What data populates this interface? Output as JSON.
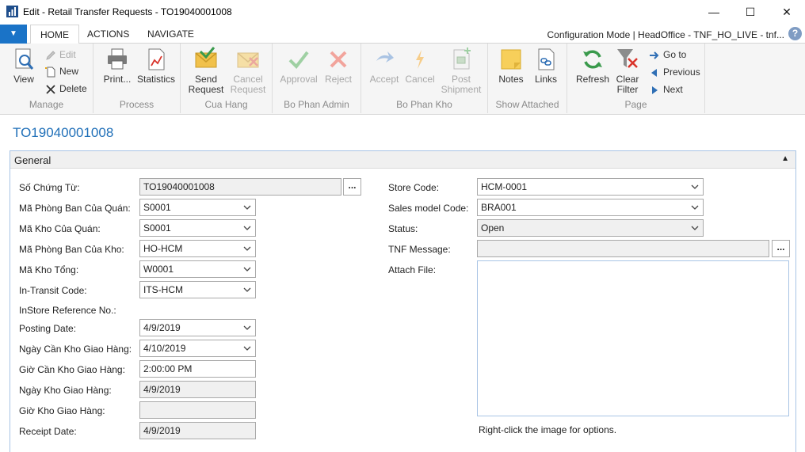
{
  "window": {
    "title": "Edit - Retail Transfer Requests - TO19040001008",
    "minimize": "—",
    "maximize": "☐",
    "close": "✕"
  },
  "tabs": {
    "file_menu": "▼",
    "home": "HOME",
    "actions": "ACTIONS",
    "navigate": "NAVIGATE",
    "config_status": "Configuration Mode | HeadOffice - TNF_HO_LIVE - tnf...",
    "help": "?"
  },
  "ribbon": {
    "manage": {
      "label": "Manage",
      "view": "View",
      "edit": "Edit",
      "new": "New",
      "delete": "Delete"
    },
    "process": {
      "label": "Process",
      "print": "Print...",
      "statistics": "Statistics"
    },
    "cua_hang": {
      "label": "Cua Hang",
      "send_l1": "Send",
      "send_l2": "Request",
      "cancel_l1": "Cancel",
      "cancel_l2": "Request"
    },
    "bo_phan_admin": {
      "label": "Bo Phan Admin",
      "approval": "Approval",
      "reject": "Reject"
    },
    "bo_phan_kho": {
      "label": "Bo Phan Kho",
      "accept": "Accept",
      "cancel": "Cancel",
      "post_l1": "Post",
      "post_l2": "Shipment"
    },
    "show_attached": {
      "label": "Show Attached",
      "notes": "Notes",
      "links": "Links"
    },
    "page": {
      "label": "Page",
      "refresh": "Refresh",
      "clear_l1": "Clear",
      "clear_l2": "Filter",
      "goto": "Go to",
      "previous": "Previous",
      "next": "Next"
    }
  },
  "page_title": "TO19040001008",
  "general": {
    "header": "General",
    "left": [
      {
        "label": "Số Chứng Từ:",
        "value": "TO19040001008"
      },
      {
        "label": "Mã Phòng Ban Của Quán:",
        "value": "S0001"
      },
      {
        "label": "Mã Kho Của Quán:",
        "value": "S0001"
      },
      {
        "label": "Mã Phòng Ban Của Kho:",
        "value": "HO-HCM"
      },
      {
        "label": "Mã Kho Tổng:",
        "value": "W0001"
      },
      {
        "label": "In-Transit Code:",
        "value": "ITS-HCM"
      },
      {
        "label": "InStore Reference No.:",
        "value": ""
      },
      {
        "label": "Posting Date:",
        "value": "4/9/2019"
      },
      {
        "label": "Ngày Cần Kho Giao Hàng:",
        "value": "4/10/2019"
      },
      {
        "label": "Giờ Cần Kho Giao Hàng:",
        "value": "2:00:00 PM"
      },
      {
        "label": "Ngày Kho Giao Hàng:",
        "value": "4/9/2019"
      },
      {
        "label": "Giờ Kho Giao Hàng:",
        "value": ""
      },
      {
        "label": "Receipt Date:",
        "value": "4/9/2019"
      }
    ],
    "right": [
      {
        "label": "Store Code:",
        "value": "HCM-0001"
      },
      {
        "label": "Sales model Code:",
        "value": "BRA001"
      },
      {
        "label": "Status:",
        "value": "Open"
      },
      {
        "label": "TNF Message:",
        "value": ""
      },
      {
        "label": "Attach File:",
        "value": ""
      }
    ],
    "ellipsis": "...",
    "attach_hint": "Right-click the image for options."
  }
}
